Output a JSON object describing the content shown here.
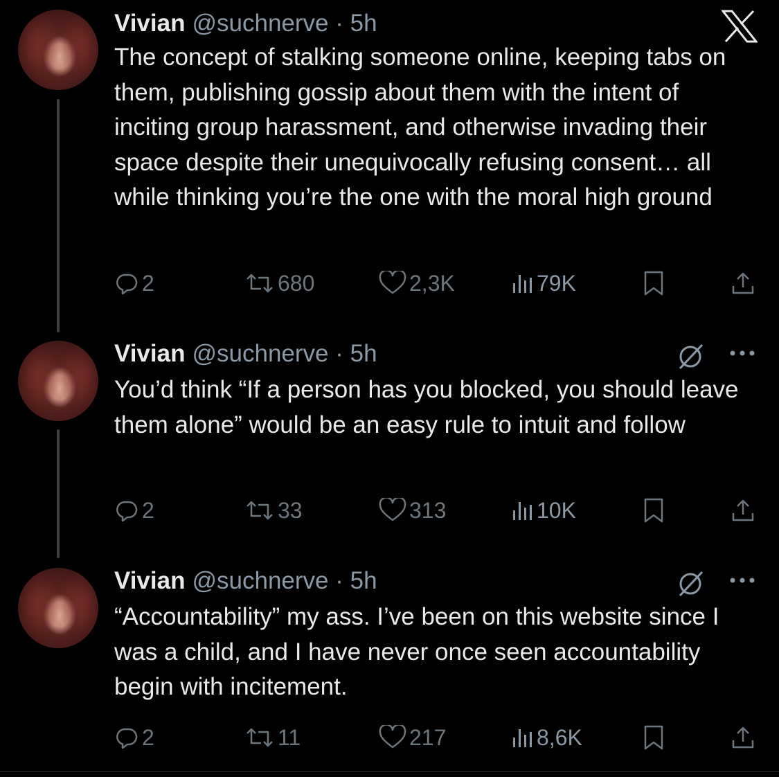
{
  "tweets": [
    {
      "name": "Vivian",
      "meta": "@suchnerve · 5h",
      "text": "The concept of stalking someone online, keeping tabs on them, publishing gossip about them with the intent of inciting group harassment, and otherwise invading their space despite their unequivocally refusing consent… all while thinking you’re the one with the moral high ground",
      "replies": "2",
      "retweets": "680",
      "likes": "2,3K",
      "views": "79K"
    },
    {
      "name": "Vivian",
      "meta": "@suchnerve · 5h",
      "text": "You’d think “If a person has you blocked, you should leave them alone” would be an easy rule to intuit and follow",
      "replies": "2",
      "retweets": "33",
      "likes": "313",
      "views": "10K"
    },
    {
      "name": "Vivian",
      "meta": "@suchnerve · 5h",
      "text": "“Accountability” my ass. I’ve been on this website since I was a child, and I have never once seen accountability begin with incitement.",
      "replies": "2",
      "retweets": "11",
      "likes": "217",
      "views": "8,6K"
    }
  ],
  "icons": {
    "logo": "x-logo-icon",
    "reply": "reply-icon",
    "retweet": "retweet-icon",
    "like": "heart-icon",
    "views": "views-icon",
    "bookmark": "bookmark-icon",
    "share": "share-icon",
    "grok": "grok-icon",
    "more": "more-icon"
  },
  "colors": {
    "background": "#000000",
    "text": "#e7e9ea",
    "secondary": "#8b98a5",
    "action": "#6e767d",
    "thread_line": "#3e4144"
  }
}
